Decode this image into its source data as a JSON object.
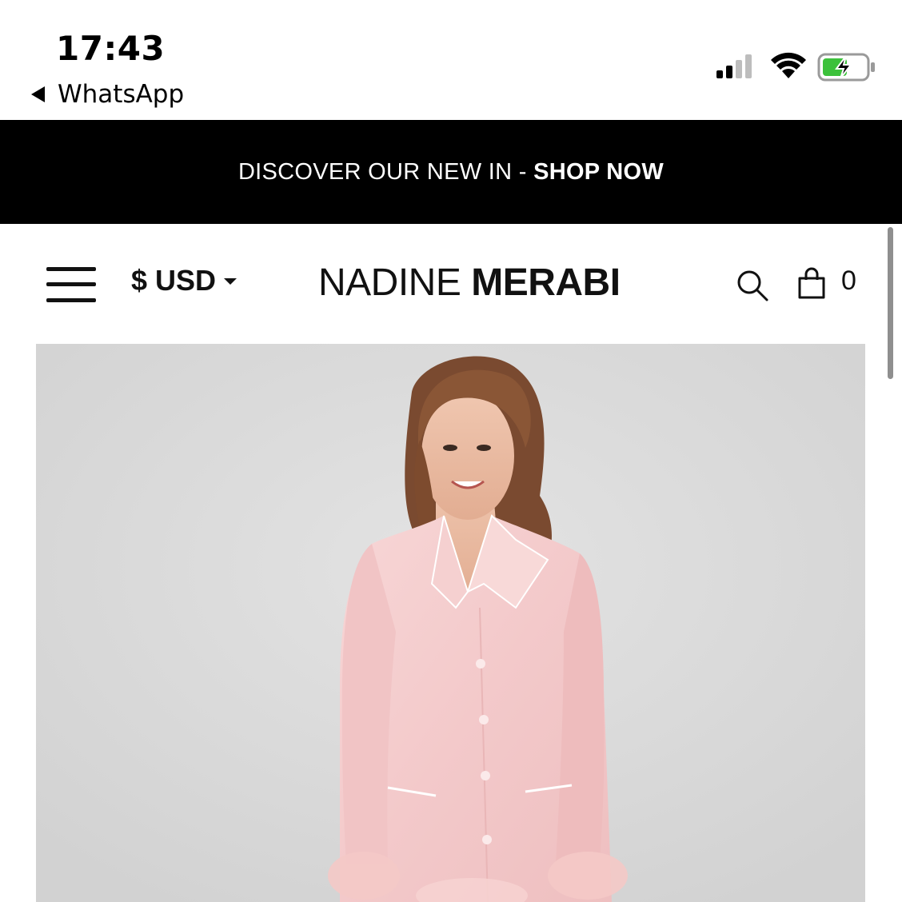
{
  "status_bar": {
    "time": "17:43",
    "back_app": "WhatsApp",
    "icons": [
      "signal-icon",
      "wifi-icon",
      "battery-charging-icon"
    ]
  },
  "announcement": {
    "text": "DISCOVER OUR NEW IN - ",
    "cta": "SHOP NOW"
  },
  "header": {
    "currency": "$ USD",
    "brand_light": "NADINE ",
    "brand_bold": "MERABI",
    "cart_count": "0",
    "icons": [
      "menu-icon",
      "search-icon",
      "shopping-bag-icon"
    ]
  },
  "product": {
    "image_subject": "model wearing pink satin pajama shirt with feather cuffs"
  },
  "colors": {
    "announcement_bg": "#000000",
    "text": "#111111",
    "image_bg": "#d8d8d8",
    "battery_green": "#3cc13b",
    "garment_pink": "#f6cfd0"
  }
}
